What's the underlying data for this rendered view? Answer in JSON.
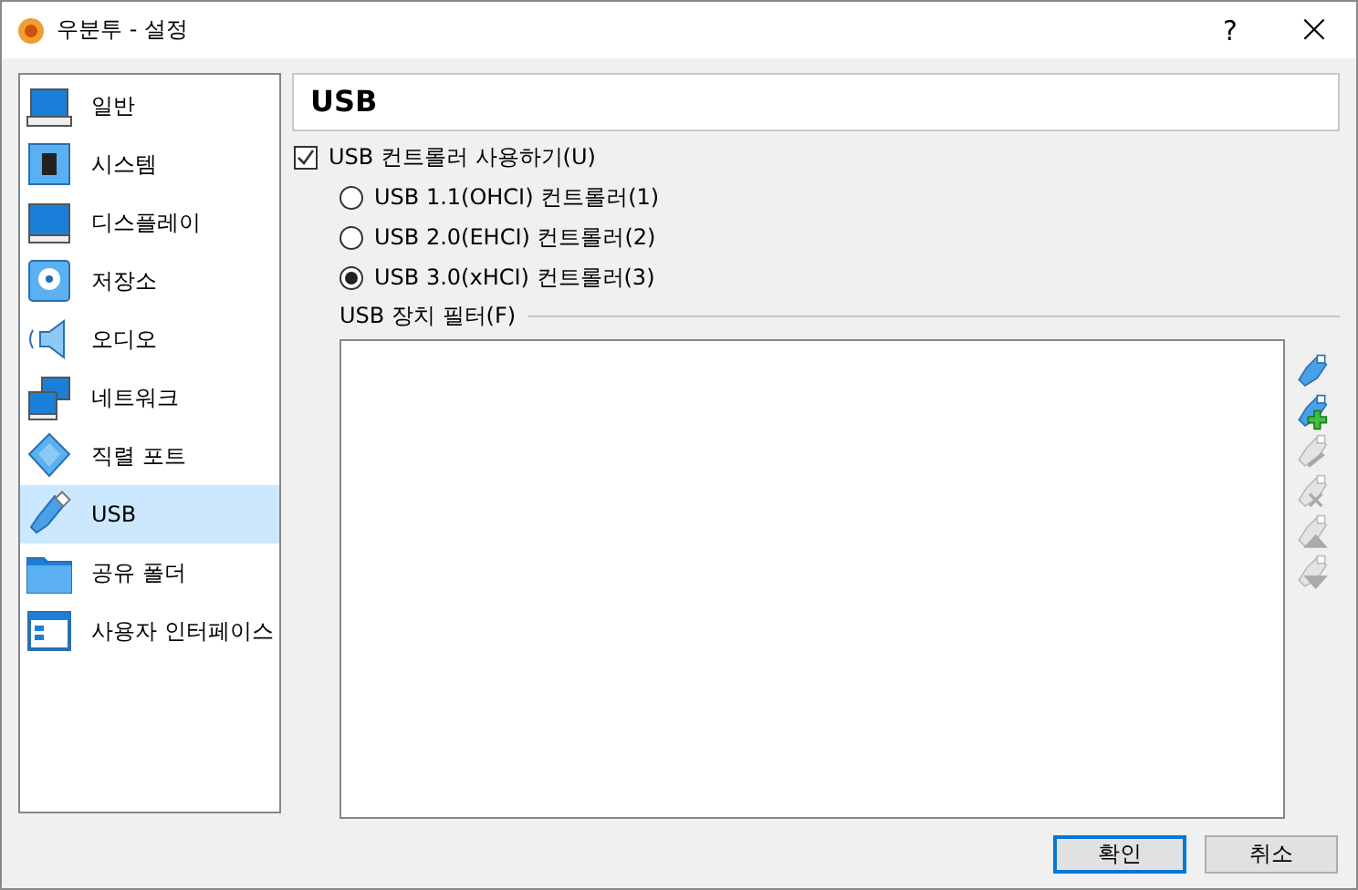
{
  "window": {
    "title": "우분투 - 설정",
    "help": "?",
    "close": "×"
  },
  "sidebar": {
    "items": [
      {
        "label": "일반",
        "kind": "general",
        "selected": false
      },
      {
        "label": "시스템",
        "kind": "system",
        "selected": false
      },
      {
        "label": "디스플레이",
        "kind": "display",
        "selected": false
      },
      {
        "label": "저장소",
        "kind": "storage",
        "selected": false
      },
      {
        "label": "오디오",
        "kind": "audio",
        "selected": false
      },
      {
        "label": "네트워크",
        "kind": "network",
        "selected": false
      },
      {
        "label": "직렬 포트",
        "kind": "serial",
        "selected": false
      },
      {
        "label": "USB",
        "kind": "usb",
        "selected": true
      },
      {
        "label": "공유 폴더",
        "kind": "folder",
        "selected": false
      },
      {
        "label": "사용자 인터페이스",
        "kind": "ui",
        "selected": false
      }
    ]
  },
  "page": {
    "title": "USB",
    "enable": {
      "label": "USB 컨트롤러 사용하기(U)",
      "checked": true
    },
    "controllers": [
      {
        "label": "USB 1.1(OHCI) 컨트롤러(1)",
        "selected": false
      },
      {
        "label": "USB 2.0(EHCI) 컨트롤러(2)",
        "selected": false
      },
      {
        "label": "USB 3.0(xHCI) 컨트롤러(3)",
        "selected": true
      }
    ],
    "filters": {
      "label": "USB 장치 필터(F)",
      "tools": [
        {
          "kind": "add",
          "disabled": false
        },
        {
          "kind": "add-plus",
          "disabled": false
        },
        {
          "kind": "edit",
          "disabled": true
        },
        {
          "kind": "remove",
          "disabled": true
        },
        {
          "kind": "up",
          "disabled": true
        },
        {
          "kind": "down",
          "disabled": true
        }
      ]
    }
  },
  "buttons": [
    {
      "label": "확인",
      "default": true
    },
    {
      "label": "취소",
      "default": false
    }
  ]
}
